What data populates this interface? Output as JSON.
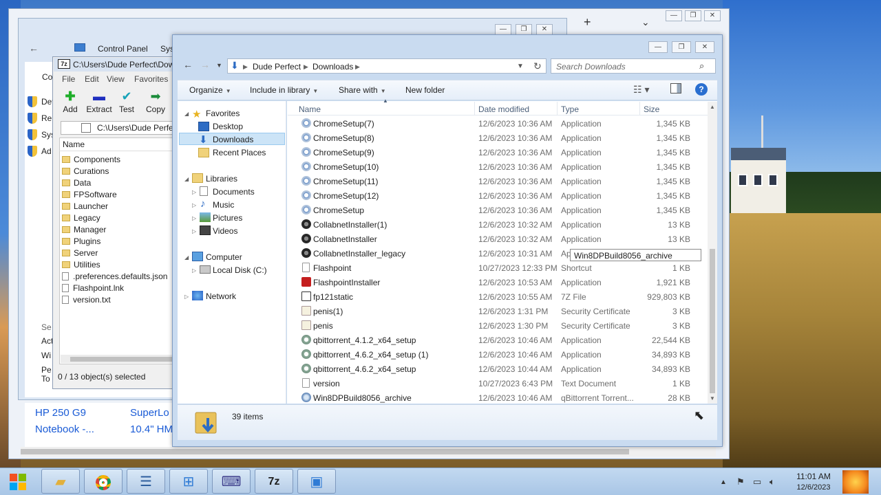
{
  "browser": {
    "products": [
      {
        "line1": "HP 250 G9",
        "line2": "Notebook -..."
      },
      {
        "line1": "SuperLo",
        "line2": "10.4\" HM"
      }
    ]
  },
  "control_panel": {
    "breadcrumb": [
      "Control Panel",
      "Syst"
    ],
    "links": [
      "Dev",
      "Re",
      "Sys",
      "Ad"
    ],
    "bottom_links": [
      "Se",
      "Act",
      "Wi",
      "Pe",
      "To"
    ],
    "side_letter": "Co"
  },
  "zip": {
    "title": "C:\\Users\\Dude Perfect\\Down",
    "menu": [
      "File",
      "Edit",
      "View",
      "Favorites"
    ],
    "tools": [
      {
        "label": "Add",
        "icon": "plus-icon"
      },
      {
        "label": "Extract",
        "icon": "minus-icon"
      },
      {
        "label": "Test",
        "icon": "check-icon"
      },
      {
        "label": "Copy",
        "icon": "arrow-icon"
      }
    ],
    "path": "C:\\Users\\Dude Perfect",
    "column_name": "Name",
    "items": [
      {
        "name": "Components",
        "kind": "folder"
      },
      {
        "name": "Curations",
        "kind": "folder"
      },
      {
        "name": "Data",
        "kind": "folder"
      },
      {
        "name": "FPSoftware",
        "kind": "folder"
      },
      {
        "name": "Launcher",
        "kind": "folder"
      },
      {
        "name": "Legacy",
        "kind": "folder"
      },
      {
        "name": "Manager",
        "kind": "folder"
      },
      {
        "name": "Plugins",
        "kind": "folder"
      },
      {
        "name": "Server",
        "kind": "folder"
      },
      {
        "name": "Utilities",
        "kind": "folder"
      },
      {
        "name": ".preferences.defaults.json",
        "kind": "file"
      },
      {
        "name": "Flashpoint.lnk",
        "kind": "file"
      },
      {
        "name": "version.txt",
        "kind": "file"
      }
    ],
    "status": "0 / 13 object(s) selected"
  },
  "explorer": {
    "address": [
      "Dude Perfect",
      "Downloads"
    ],
    "search_placeholder": "Search Downloads",
    "commands": {
      "organize": "Organize",
      "include": "Include in library",
      "share": "Share with",
      "new_folder": "New folder"
    },
    "nav": {
      "favorites": "Favorites",
      "desktop": "Desktop",
      "downloads": "Downloads",
      "recent": "Recent Places",
      "libraries": "Libraries",
      "documents": "Documents",
      "music": "Music",
      "pictures": "Pictures",
      "videos": "Videos",
      "computer": "Computer",
      "local_disk": "Local Disk (C:)",
      "network": "Network"
    },
    "columns": {
      "name": "Name",
      "date": "Date modified",
      "type": "Type",
      "size": "Size"
    },
    "files": [
      {
        "name": "ChromeSetup(7)",
        "date": "12/6/2023 10:36 AM",
        "type": "Application",
        "size": "1,345 KB",
        "icon": "chrome"
      },
      {
        "name": "ChromeSetup(8)",
        "date": "12/6/2023 10:36 AM",
        "type": "Application",
        "size": "1,345 KB",
        "icon": "chrome"
      },
      {
        "name": "ChromeSetup(9)",
        "date": "12/6/2023 10:36 AM",
        "type": "Application",
        "size": "1,345 KB",
        "icon": "chrome"
      },
      {
        "name": "ChromeSetup(10)",
        "date": "12/6/2023 10:36 AM",
        "type": "Application",
        "size": "1,345 KB",
        "icon": "chrome"
      },
      {
        "name": "ChromeSetup(11)",
        "date": "12/6/2023 10:36 AM",
        "type": "Application",
        "size": "1,345 KB",
        "icon": "chrome"
      },
      {
        "name": "ChromeSetup(12)",
        "date": "12/6/2023 10:36 AM",
        "type": "Application",
        "size": "1,345 KB",
        "icon": "chrome"
      },
      {
        "name": "ChromeSetup",
        "date": "12/6/2023 10:36 AM",
        "type": "Application",
        "size": "1,345 KB",
        "icon": "chrome"
      },
      {
        "name": "CollabnetInstaller(1)",
        "date": "12/6/2023 10:32 AM",
        "type": "Application",
        "size": "13 KB",
        "icon": "gear"
      },
      {
        "name": "CollabnetInstaller",
        "date": "12/6/2023 10:32 AM",
        "type": "Application",
        "size": "13 KB",
        "icon": "gear"
      },
      {
        "name": "CollabnetInstaller_legacy",
        "date": "12/6/2023 10:31 AM",
        "type": "Ap",
        "size": "",
        "icon": "gear"
      },
      {
        "name": "Flashpoint",
        "date": "10/27/2023 12:33 PM",
        "type": "Shortcut",
        "size": "1 KB",
        "icon": "doc"
      },
      {
        "name": "FlashpointInstaller",
        "date": "12/6/2023 10:53 AM",
        "type": "Application",
        "size": "1,921 KB",
        "icon": "red"
      },
      {
        "name": "fp121static",
        "date": "12/6/2023 10:55 AM",
        "type": "7Z File",
        "size": "929,803 KB",
        "icon": "zz"
      },
      {
        "name": "penis(1)",
        "date": "12/6/2023 1:31 PM",
        "type": "Security Certificate",
        "size": "3 KB",
        "icon": "cert"
      },
      {
        "name": "penis",
        "date": "12/6/2023 1:30 PM",
        "type": "Security Certificate",
        "size": "3 KB",
        "icon": "cert"
      },
      {
        "name": "qbittorrent_4.1.2_x64_setup",
        "date": "12/6/2023 10:46 AM",
        "type": "Application",
        "size": "22,544 KB",
        "icon": "qb"
      },
      {
        "name": "qbittorrent_4.6.2_x64_setup (1)",
        "date": "12/6/2023 10:46 AM",
        "type": "Application",
        "size": "34,893 KB",
        "icon": "qb"
      },
      {
        "name": "qbittorrent_4.6.2_x64_setup",
        "date": "12/6/2023 10:44 AM",
        "type": "Application",
        "size": "34,893 KB",
        "icon": "qb"
      },
      {
        "name": "version",
        "date": "10/27/2023 6:43 PM",
        "type": "Text Document",
        "size": "1 KB",
        "icon": "doc"
      },
      {
        "name": "Win8DPBuild8056_archive",
        "date": "12/6/2023 10:46 AM",
        "type": "qBittorrent Torrent...",
        "size": "28 KB",
        "icon": "tor"
      }
    ],
    "rename_value": "Win8DPBuild8056_archive",
    "item_count": "39 items"
  },
  "taskbar": {
    "apps": [
      {
        "name": "file-explorer",
        "icon": "folder-icon"
      },
      {
        "name": "chrome",
        "icon": "chrome-icon"
      },
      {
        "name": "task-list",
        "icon": "list-icon"
      },
      {
        "name": "windows-logo",
        "icon": "windows-icon"
      },
      {
        "name": "keyboard-app",
        "icon": "keyboard-icon"
      },
      {
        "name": "7zip",
        "icon": "7z-icon",
        "label": "7z"
      },
      {
        "name": "control-panel",
        "icon": "control-panel-icon"
      }
    ],
    "time": "11:01 AM",
    "date": "12/6/2023"
  }
}
